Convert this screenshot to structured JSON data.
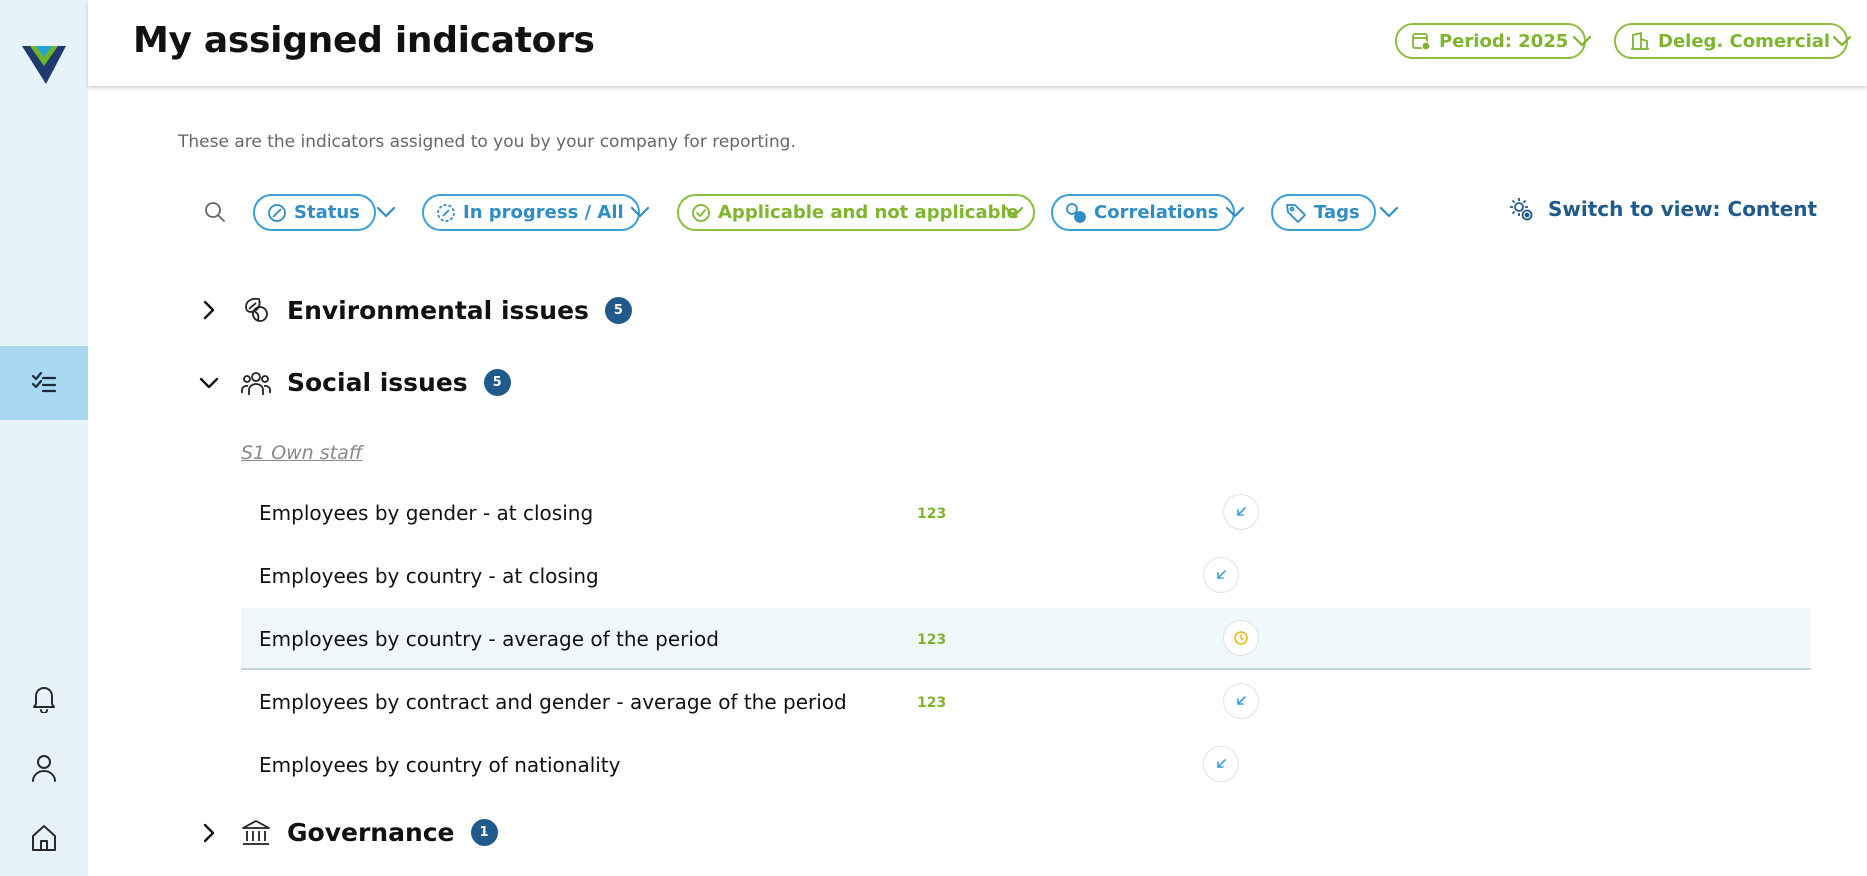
{
  "header": {
    "title": "My assigned indicators",
    "period_label": "Period: 2025",
    "delegation_label": "Deleg. Comercial"
  },
  "intro": "These are the indicators assigned to you by your company for reporting.",
  "filters": {
    "status": "Status",
    "progress": "In progress / All",
    "applicability": "Applicable and not applicable",
    "correlations": "Correlations",
    "tags": "Tags"
  },
  "switch_view": "Switch to view: Content",
  "sections": [
    {
      "title": "Environmental issues",
      "count": "5",
      "expanded": false
    },
    {
      "title": "Social issues",
      "count": "5",
      "expanded": true
    },
    {
      "title": "Governance",
      "count": "1",
      "expanded": false
    }
  ],
  "subgroup": "S1 Own staff",
  "indicators": [
    {
      "name": "Employees by gender - at closing",
      "type": "123",
      "status_icon": "arrow-in-icon"
    },
    {
      "name": "Employees by country - at closing",
      "type": "",
      "status_icon": "arrow-in-icon"
    },
    {
      "name": "Employees by country - average of the period",
      "type": "123",
      "status_icon": "clock-icon"
    },
    {
      "name": "Employees by contract and gender - average of the period",
      "type": "123",
      "status_icon": "arrow-in-icon"
    },
    {
      "name": "Employees by country of nationality",
      "type": "",
      "status_icon": "arrow-in-icon"
    }
  ],
  "colors": {
    "accent_green": "#8cbf3f",
    "accent_blue": "#3aa0d6",
    "brand_navy": "#1f5a8a",
    "sidebar_bg": "#e6f3fa",
    "sidebar_active": "#a9d9f2"
  }
}
